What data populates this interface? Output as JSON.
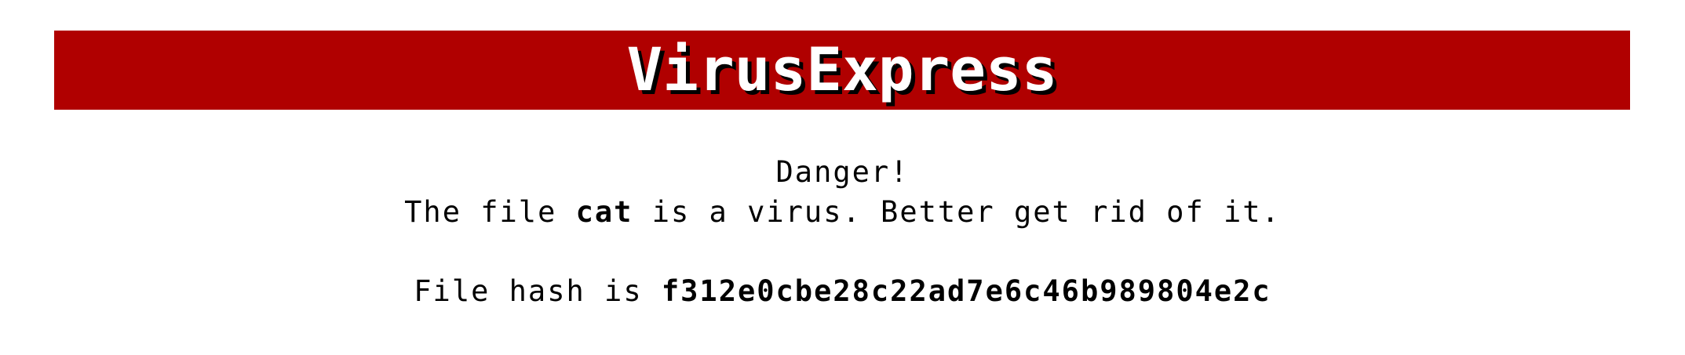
{
  "header": {
    "title": "VirusExpress"
  },
  "alert": {
    "heading": "Danger!",
    "message_prefix": "The file ",
    "file_name": "cat",
    "message_suffix": " is a virus. Better get rid of it."
  },
  "hash": {
    "label": "File hash is ",
    "value": "f312e0cbe28c22ad7e6c46b989804e2c"
  },
  "colors": {
    "banner": "#b00000",
    "title_text": "#ffffff",
    "title_shadow": "#000000"
  }
}
